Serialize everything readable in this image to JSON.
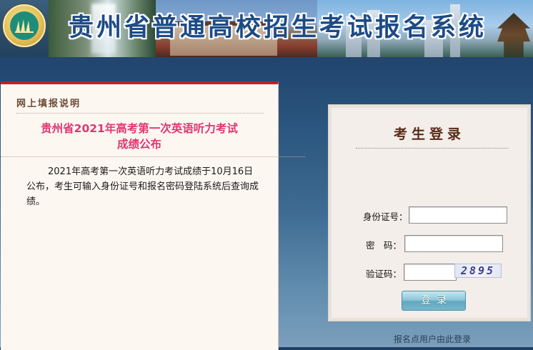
{
  "banner": {
    "title": "贵州省普通高校招生考试报名系统"
  },
  "notice": {
    "header": "网上填报说明",
    "title_line1": "贵州省2021年高考第一次英语听力考试",
    "title_line2": "成绩公布",
    "body": "2021年高考第一次英语听力考试成绩于10月16日公布，考生可输入身份证号和报名密码登陆系统后查询成绩。"
  },
  "login": {
    "title": "考生登录",
    "id_label": "身份证号：",
    "id_value": "",
    "password_label": "密　码：",
    "password_value": "",
    "captcha_label": "验证码：",
    "captcha_value": "",
    "captcha_image_text": "2895",
    "submit_label": "登录"
  },
  "footer": {
    "entry_link": "报名点用户由此登录"
  },
  "colors": {
    "accent_red": "#b6232a",
    "notice_title": "#e0366e",
    "login_title": "#5a2a1a"
  }
}
